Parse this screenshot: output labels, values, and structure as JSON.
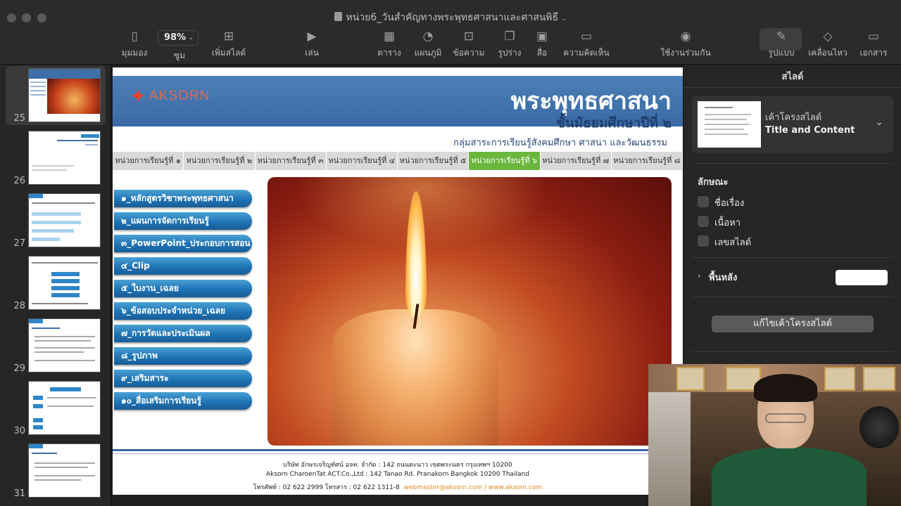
{
  "window": {
    "title": "หน่วย6_วันสำคัญทางพระพุทธศาสนาและศาสนพิธี"
  },
  "toolbar": {
    "zoom_value": "98%",
    "items": [
      {
        "label": "มุมมอง",
        "icon": "sidebar-icon"
      },
      {
        "label": "ซูม",
        "icon": "zoom-icon"
      },
      {
        "label": "เพิ่มสไลด์",
        "icon": "add-slide-icon"
      },
      {
        "label": "เล่น",
        "icon": "play-icon"
      },
      {
        "label": "ตาราง",
        "icon": "table-icon"
      },
      {
        "label": "แผนภูมิ",
        "icon": "chart-icon"
      },
      {
        "label": "ข้อความ",
        "icon": "text-icon"
      },
      {
        "label": "รูปร่าง",
        "icon": "shape-icon"
      },
      {
        "label": "สื่อ",
        "icon": "media-icon"
      },
      {
        "label": "ความคิดเห็น",
        "icon": "comment-icon"
      },
      {
        "label": "ใช้งานร่วมกัน",
        "icon": "collaborate-icon"
      },
      {
        "label": "รูปแบบ",
        "icon": "format-brush-icon"
      },
      {
        "label": "เคลื่อนไหว",
        "icon": "animate-icon"
      },
      {
        "label": "เอกสาร",
        "icon": "document-icon"
      }
    ]
  },
  "navigator": {
    "slides": [
      "25",
      "26",
      "27",
      "28",
      "29",
      "30",
      "31"
    ],
    "selected": "25"
  },
  "slide": {
    "logo": "AKSORN",
    "title": "พระพุทธศาสนา",
    "subtitle": "ชั้นมัธยมศึกษาปีที่ ๒",
    "subject": "กลุ่มสาระการเรียนรู้สังคมศึกษา ศาสนา และวัฒนธรรม",
    "tabs": [
      "หน่วยการเรียนรู้ที่ ๑",
      "หน่วยการเรียนรู้ที่ ๒",
      "หน่วยการเรียนรู้ที่ ๓",
      "หน่วยการเรียนรู้ที่ ๔",
      "หน่วยการเรียนรู้ที่ ๕",
      "หน่วยการเรียนรู้ที่ ๖",
      "หน่วยการเรียนรู้ที่ ๗",
      "หน่วยการเรียนรู้ที่ ๘"
    ],
    "active_tab": "หน่วยการเรียนรู้ที่ ๖",
    "menu": [
      "๑_หลักสูตรวิชาพระพุทธศาสนา",
      "๒_แผนการจัดการเรียนรู้",
      "๓_PowerPoint_ประกอบการสอน",
      "๔_Clip",
      "๕_ใบงาน_เฉลย",
      "๖_ข้อสอบประจำหน่วย_เฉลย",
      "๗_การวัดและประเมินผล",
      "๘_รูปภาพ",
      "๙_เสริมสาระ",
      "๑๐_สื่อเสริมการเรียนรู้"
    ],
    "footer": {
      "line1": "บริษัท อักษรเจริญทัศน์ อจท. จำกัด : 142 ถนนตะนาว เขตพระนคร กรุงเทพฯ 10200",
      "line2": "Aksorn CharoenTat ACT.Co.,Ltd : 142 Tanao Rd. Pranakorn Bangkok 10200 Thailand",
      "phone": "โทรศัพท์ : 02 622 2999  โทรสาร : 02 622 1311-8",
      "links": "webmaster@aksorn.com / www.aksorn.com"
    },
    "colors": {
      "header_blue": "#3a6aa4",
      "active_tab_green": "#6ab73e",
      "menu_blue": "#1f74b5",
      "link_orange": "#e08a1e"
    }
  },
  "inspector": {
    "panel_title": "สไลด์",
    "layout_label": "เค้าโครงสไลด์",
    "layout_name": "Title and Content",
    "appearance_label": "ลักษณะ",
    "checkboxes": [
      "ชื่อเรื่อง",
      "เนื้อหา",
      "เลขสไลด์"
    ],
    "background_label": "พื้นหลัง",
    "edit_layout_button": "แก้ไขเค้าโครงสไลด์"
  }
}
